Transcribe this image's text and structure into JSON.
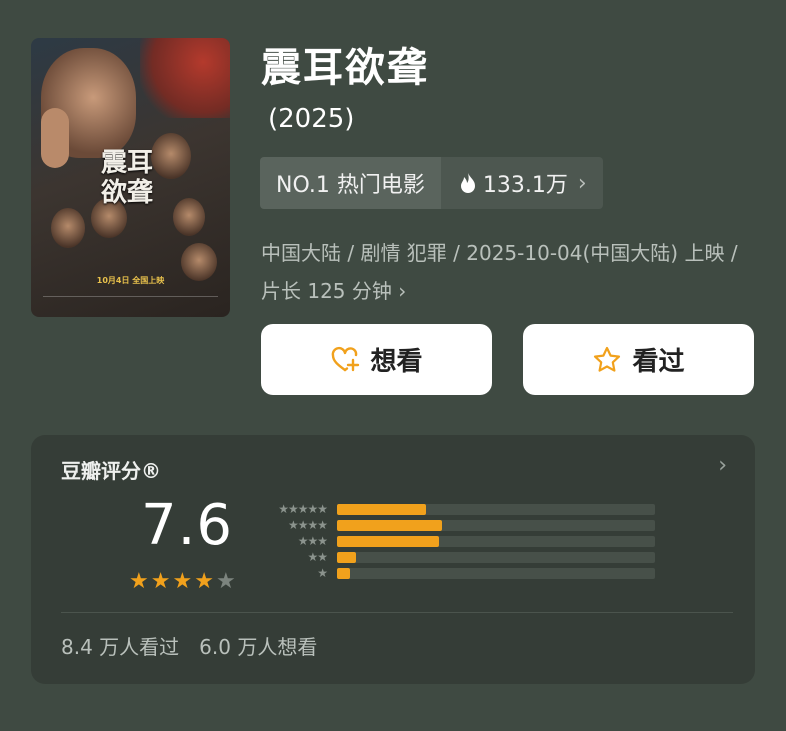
{
  "poster": {
    "title_text": "震耳欲聋",
    "release_text": "10月4日 全国上映"
  },
  "movie": {
    "title": "震耳欲聋",
    "year": "(2025)"
  },
  "ranking": {
    "label": "NO.1 热门电影",
    "heat": "133.1万"
  },
  "meta": {
    "line": "中国大陆 / 剧情 犯罪 / 2025-10-04(中国大陆) 上映 / 片长 125 分钟"
  },
  "actions": {
    "want_label": "想看",
    "seen_label": "看过"
  },
  "rating": {
    "section_title": "豆瓣评分®",
    "score": "7.6",
    "stars_filled": 4,
    "stars_total": 5,
    "distribution": [
      {
        "stars": 5,
        "fraction": 0.28
      },
      {
        "stars": 4,
        "fraction": 0.33
      },
      {
        "stars": 3,
        "fraction": 0.32
      },
      {
        "stars": 2,
        "fraction": 0.06
      },
      {
        "stars": 1,
        "fraction": 0.04
      }
    ],
    "watched_count": "8.4 万人看过",
    "want_count": "6.0 万人想看"
  },
  "colors": {
    "background": "#3f4a42",
    "accent": "#f1a11c",
    "card": "#353d37"
  },
  "icons": {
    "heat": "flame-icon",
    "want": "heart-plus-icon",
    "seen": "star-outline-icon",
    "chevron": "chevron-right-icon"
  }
}
